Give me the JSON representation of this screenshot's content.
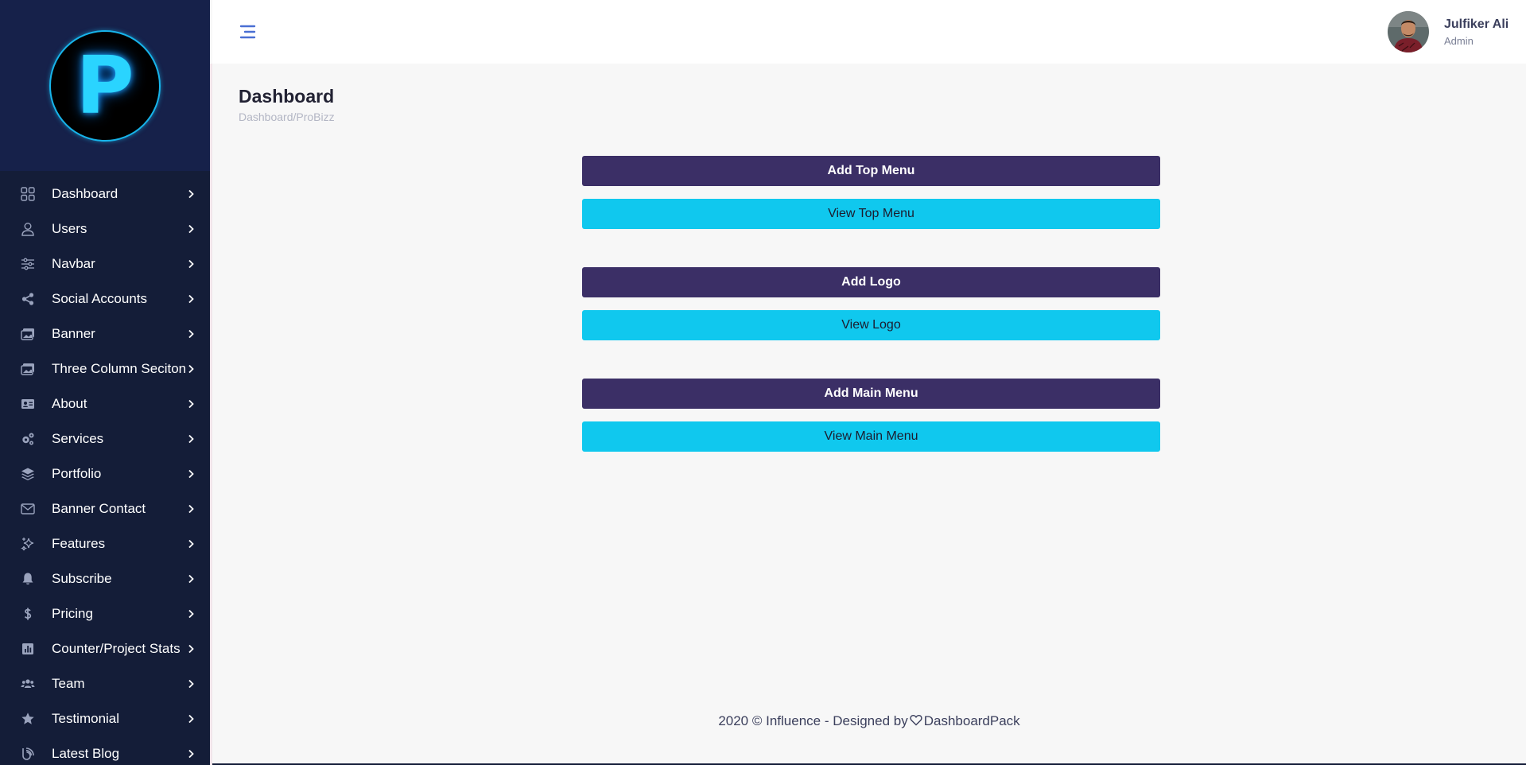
{
  "sidebar": {
    "logo_letter": "P",
    "items": [
      {
        "label": "Dashboard",
        "icon": "grid-icon"
      },
      {
        "label": "Users",
        "icon": "user-icon"
      },
      {
        "label": "Navbar",
        "icon": "sliders-icon"
      },
      {
        "label": "Social Accounts",
        "icon": "share-icon"
      },
      {
        "label": "Banner",
        "icon": "images-icon"
      },
      {
        "label": "Three Column Seciton",
        "icon": "images-icon"
      },
      {
        "label": "About",
        "icon": "id-card-icon"
      },
      {
        "label": "Services",
        "icon": "cogs-icon"
      },
      {
        "label": "Portfolio",
        "icon": "layers-icon"
      },
      {
        "label": "Banner Contact",
        "icon": "envelope-icon"
      },
      {
        "label": "Features",
        "icon": "sparkles-icon"
      },
      {
        "label": "Subscribe",
        "icon": "bell-icon"
      },
      {
        "label": "Pricing",
        "icon": "dollar-icon"
      },
      {
        "label": "Counter/Project Stats",
        "icon": "chart-icon"
      },
      {
        "label": "Team",
        "icon": "users-icon"
      },
      {
        "label": "Testimonial",
        "icon": "star-icon"
      },
      {
        "label": "Latest Blog",
        "icon": "blog-icon"
      }
    ]
  },
  "header": {
    "user_name": "Julfiker Ali",
    "user_role": "Admin"
  },
  "page": {
    "title": "Dashboard",
    "breadcrumb": "Dashboard/ProBizz"
  },
  "actions": {
    "add_top_menu": "Add Top Menu",
    "view_top_menu": "View Top Menu",
    "add_logo": "Add Logo",
    "view_logo": "View Logo",
    "add_main_menu": "Add Main Menu",
    "view_main_menu": "View Main Menu"
  },
  "footer": {
    "prefix": "2020 © Influence - Designed by",
    "brand": "DashboardPack"
  },
  "colors": {
    "sidebar_bg": "#141d38",
    "primary_button": "#3b2f66",
    "secondary_button": "#10c8ee",
    "accent": "#4a6fd3"
  }
}
